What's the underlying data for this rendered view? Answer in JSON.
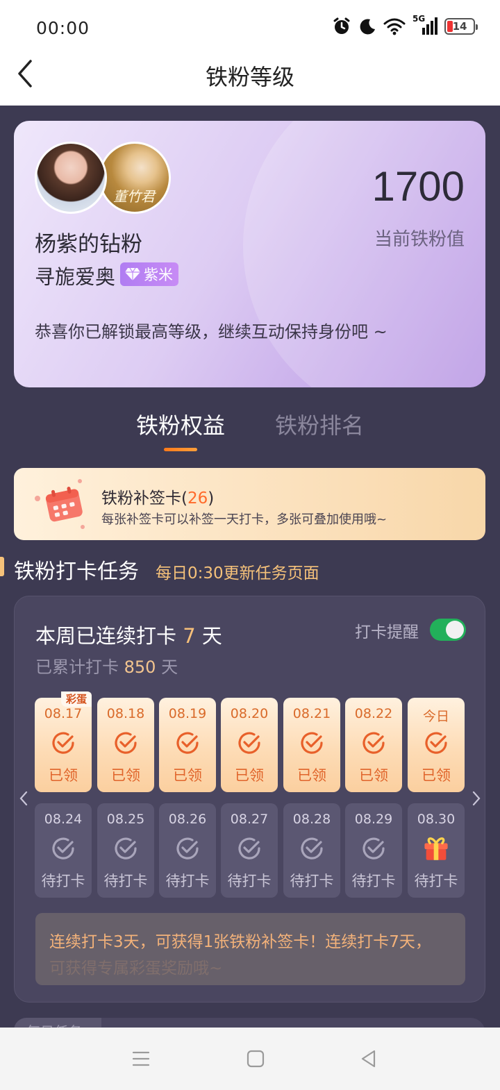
{
  "status_bar": {
    "time": "00:00",
    "network": "5G",
    "battery": "14"
  },
  "header": {
    "title": "铁粉等级"
  },
  "profile": {
    "avatar2_text": "董竹君",
    "fan_title": "杨紫的钻粉",
    "name": "寻旎爱奥",
    "badge": "紫米",
    "fan_value": "1700",
    "fan_value_label": "当前铁粉值",
    "message": "恭喜你已解锁最高等级，继续互动保持身份吧 ~"
  },
  "tabs": [
    {
      "label": "铁粉权益",
      "active": true
    },
    {
      "label": "铁粉排名",
      "active": false
    }
  ],
  "makeup_card": {
    "title": "铁粉补签卡",
    "count": "26",
    "subtitle": "每张补签卡可以补签一天打卡，多张可叠加使用哦~"
  },
  "checkin_section": {
    "title": "铁粉打卡任务",
    "subtitle": "每日0:30更新任务页面",
    "streak_prefix": "本周已连续打卡",
    "streak_days": "7",
    "streak_suffix": "天",
    "total_prefix": "已累计打卡",
    "total_days": "850",
    "total_suffix": "天",
    "reminder_label": "打卡提醒",
    "reminder_on": true,
    "egg_tag": "彩蛋",
    "week_done": [
      {
        "date": "08.17",
        "status": "已领"
      },
      {
        "date": "08.18",
        "status": "已领"
      },
      {
        "date": "08.19",
        "status": "已领"
      },
      {
        "date": "08.20",
        "status": "已领"
      },
      {
        "date": "08.21",
        "status": "已领"
      },
      {
        "date": "08.22",
        "status": "已领"
      },
      {
        "date": "今日",
        "status": "已领"
      }
    ],
    "week_pending": [
      {
        "date": "08.24",
        "status": "待打卡"
      },
      {
        "date": "08.25",
        "status": "待打卡"
      },
      {
        "date": "08.26",
        "status": "待打卡"
      },
      {
        "date": "08.27",
        "status": "待打卡"
      },
      {
        "date": "08.28",
        "status": "待打卡"
      },
      {
        "date": "08.29",
        "status": "待打卡"
      },
      {
        "date": "08.30",
        "status": "待打卡"
      }
    ],
    "notice": "连续打卡3天，可获得1张铁粉补签卡！连续打卡7天，",
    "notice_line2": "可获得专属彩蛋奖励哦~"
  },
  "next_section": {
    "tab_label": "每日任务"
  },
  "colors": {
    "accent": "#ff7a1a",
    "gold": "#f6c27a",
    "panel": "#4a4660",
    "background": "#3d3a52"
  }
}
